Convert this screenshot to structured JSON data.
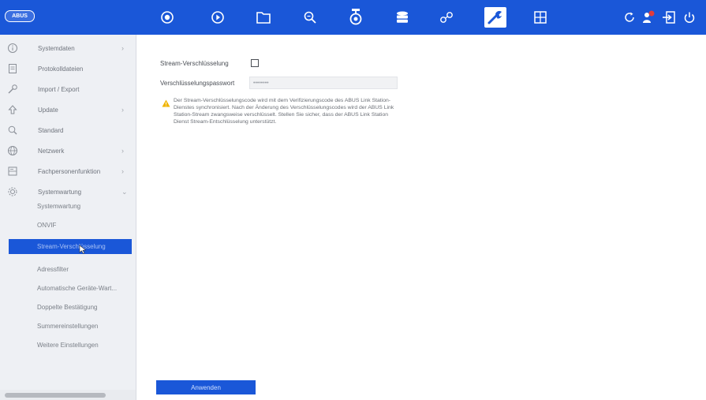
{
  "header": {
    "logo": "ABUS",
    "nav_icons": [
      "live-view-icon",
      "playback-icon",
      "file-icon",
      "search-icon",
      "camera-icon",
      "storage-icon",
      "smart-icon",
      "config-icon",
      "grid-icon"
    ],
    "active_nav": "config-icon",
    "right_icons": [
      "refresh-icon",
      "user-icon",
      "logout-icon",
      "power-icon"
    ],
    "notification_badge_color": "#e23b3b",
    "accent_color": "#1a57d8"
  },
  "sidebar": {
    "items": [
      {
        "label": "Systemdaten",
        "icon": "info-icon",
        "has_arrow": true
      },
      {
        "label": "Protokolldateien",
        "icon": "document-icon",
        "has_arrow": false
      },
      {
        "label": "Import / Export",
        "icon": "wrench-icon",
        "has_arrow": false
      },
      {
        "label": "Update",
        "icon": "upload-icon",
        "has_arrow": true
      },
      {
        "label": "Standard",
        "icon": "reset-icon",
        "has_arrow": false
      },
      {
        "label": "Netzwerk",
        "icon": "globe-icon",
        "has_arrow": true
      },
      {
        "label": "Fachpersonenfunktion",
        "icon": "server-icon",
        "has_arrow": true
      },
      {
        "label": "Systemwartung",
        "icon": "gear-icon",
        "has_arrow": true
      }
    ],
    "subitems": [
      {
        "label": "Systemwartung"
      },
      {
        "label": "ONVIF"
      },
      {
        "label": "Stream-Verschlüsselung"
      },
      {
        "label": "Adressfilter"
      },
      {
        "label": "Automatische Geräte-Wart..."
      },
      {
        "label": "Doppelte Bestätigung"
      },
      {
        "label": "Summereinstellungen"
      },
      {
        "label": "Weitere Einstellungen"
      }
    ]
  },
  "form": {
    "encryption_label": "Stream-Verschlüsselung",
    "password_label": "Verschlüsselungspasswort",
    "password_value": "••••••••",
    "warning_text": "Der Stream-Verschlüsselungscode wird mit dem Verifizierungscode des ABUS Link Station-Dienstes synchronisiert. Nach der Änderung des Verschlüsselungscodes wird der ABUS Link Station-Stream zwangsweise verschlüsselt. Stellen Sie sicher, dass der ABUS Link Station Dienst Stream-Entschlüsselung unterstützt.",
    "apply_button": "Anwenden"
  }
}
